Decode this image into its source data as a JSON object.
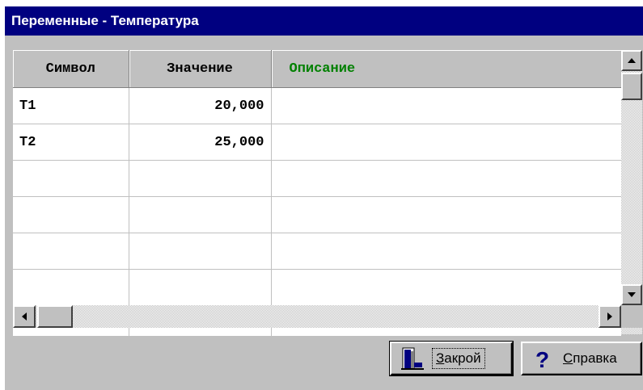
{
  "window": {
    "title": "Переменные - Температура"
  },
  "grid": {
    "columns": [
      "Символ",
      "Значение",
      "Описание"
    ],
    "rows": [
      [
        "T1",
        "20,000",
        ""
      ],
      [
        "T2",
        "25,000",
        ""
      ],
      [
        "",
        "",
        ""
      ],
      [
        "",
        "",
        ""
      ],
      [
        "",
        "",
        ""
      ],
      [
        "",
        "",
        ""
      ],
      [
        "",
        "",
        ""
      ]
    ]
  },
  "buttons": {
    "close": {
      "label_underlined": "З",
      "label_rest": "акрой",
      "icon": "door-exit-icon"
    },
    "help": {
      "label_underlined": "С",
      "label_rest": "правка",
      "icon": "question-mark-icon"
    }
  },
  "colors": {
    "titlebar": "#000080",
    "description_header": "#008000",
    "face": "#c0c0c0"
  }
}
